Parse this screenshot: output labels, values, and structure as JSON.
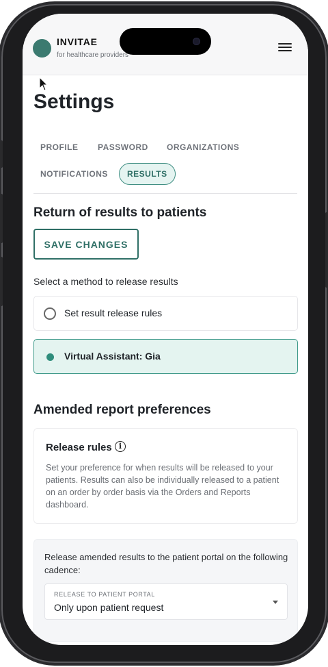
{
  "header": {
    "brand": "INVITAE",
    "subtitle": "for healthcare providers"
  },
  "page": {
    "title": "Settings"
  },
  "tabs": [
    {
      "label": "PROFILE",
      "active": false
    },
    {
      "label": "PASSWORD",
      "active": false
    },
    {
      "label": "ORGANIZATIONS",
      "active": false
    },
    {
      "label": "NOTIFICATIONS",
      "active": false
    },
    {
      "label": "RESULTS",
      "active": true
    }
  ],
  "results": {
    "heading": "Return of results to patients",
    "save_label": "SAVE CHANGES",
    "prompt": "Select a method to release results",
    "options": [
      {
        "label": "Set result release rules",
        "selected": false
      },
      {
        "label": "Virtual Assistant: Gia",
        "selected": true
      }
    ]
  },
  "amended": {
    "heading": "Amended report preferences",
    "rules_title": "Release rules",
    "rules_desc": "Set your preference for when results will be released to your patients. Results can also be individually released to a patient on an order by order basis via the Orders and Reports dashboard.",
    "cadence_text": "Release amended results to the patient portal on the following cadence:",
    "select_label": "RELEASE TO PATIENT PORTAL",
    "select_value": "Only upon patient request"
  },
  "colors": {
    "accent": "#2f6f66",
    "selected_bg": "#e4f4f0",
    "logo": "#3b7a70"
  },
  "icons": [
    "menu-icon",
    "info-icon",
    "mouse-cursor-icon"
  ]
}
